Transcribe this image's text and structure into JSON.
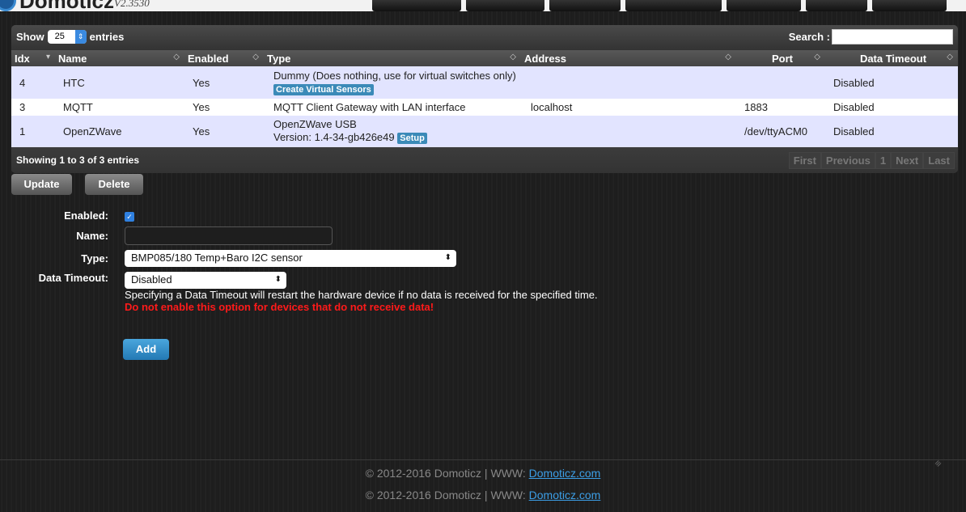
{
  "header": {
    "logo": "Domoticz",
    "version": "V2.3530",
    "nav_count": 7
  },
  "table": {
    "show_label": "Show",
    "entries_value": "25",
    "entries_label": "entries",
    "search_label": "Search :",
    "search_value": "",
    "columns": [
      "Idx",
      "Name",
      "Enabled",
      "Type",
      "Address",
      "Port",
      "Data Timeout"
    ],
    "rows": [
      {
        "idx": "4",
        "name": "HTC",
        "enabled": "Yes",
        "type": "Dummy (Does nothing, use for virtual switches only)",
        "type_button": "Create Virtual Sensors",
        "address": "",
        "port": "",
        "timeout": "Disabled"
      },
      {
        "idx": "3",
        "name": "MQTT",
        "enabled": "Yes",
        "type": "MQTT Client Gateway with LAN interface",
        "address": "localhost",
        "port": "1883",
        "timeout": "Disabled"
      },
      {
        "idx": "1",
        "name": "OpenZWave",
        "enabled": "Yes",
        "type": "OpenZWave USB",
        "type_line2": "Version: 1.4-34-gb426e49",
        "type_button": "Setup",
        "address": "",
        "port": "/dev/ttyACM0",
        "timeout": "Disabled"
      }
    ],
    "info": "Showing 1 to 3 of 3 entries",
    "pagination": [
      "First",
      "Previous",
      "1",
      "Next",
      "Last"
    ]
  },
  "actions": {
    "update": "Update",
    "delete": "Delete"
  },
  "form": {
    "enabled_label": "Enabled:",
    "enabled": true,
    "name_label": "Name:",
    "name_value": "",
    "type_label": "Type:",
    "type_value": "BMP085/180 Temp+Baro I2C sensor",
    "timeout_label": "Data Timeout:",
    "timeout_value": "Disabled",
    "timeout_help": "Specifying a Data Timeout will restart the hardware device if no data is received for the specified time.",
    "timeout_warning": "Do not enable this option for devices that do not receive data!",
    "add": "Add"
  },
  "footer": {
    "text": "© 2012-2016 Domoticz | WWW: ",
    "link": "Domoticz.com"
  },
  "colors": {
    "accent": "#3b8ab8",
    "warning": "#ff1a1a",
    "row_odd": "#e2e4ff"
  }
}
